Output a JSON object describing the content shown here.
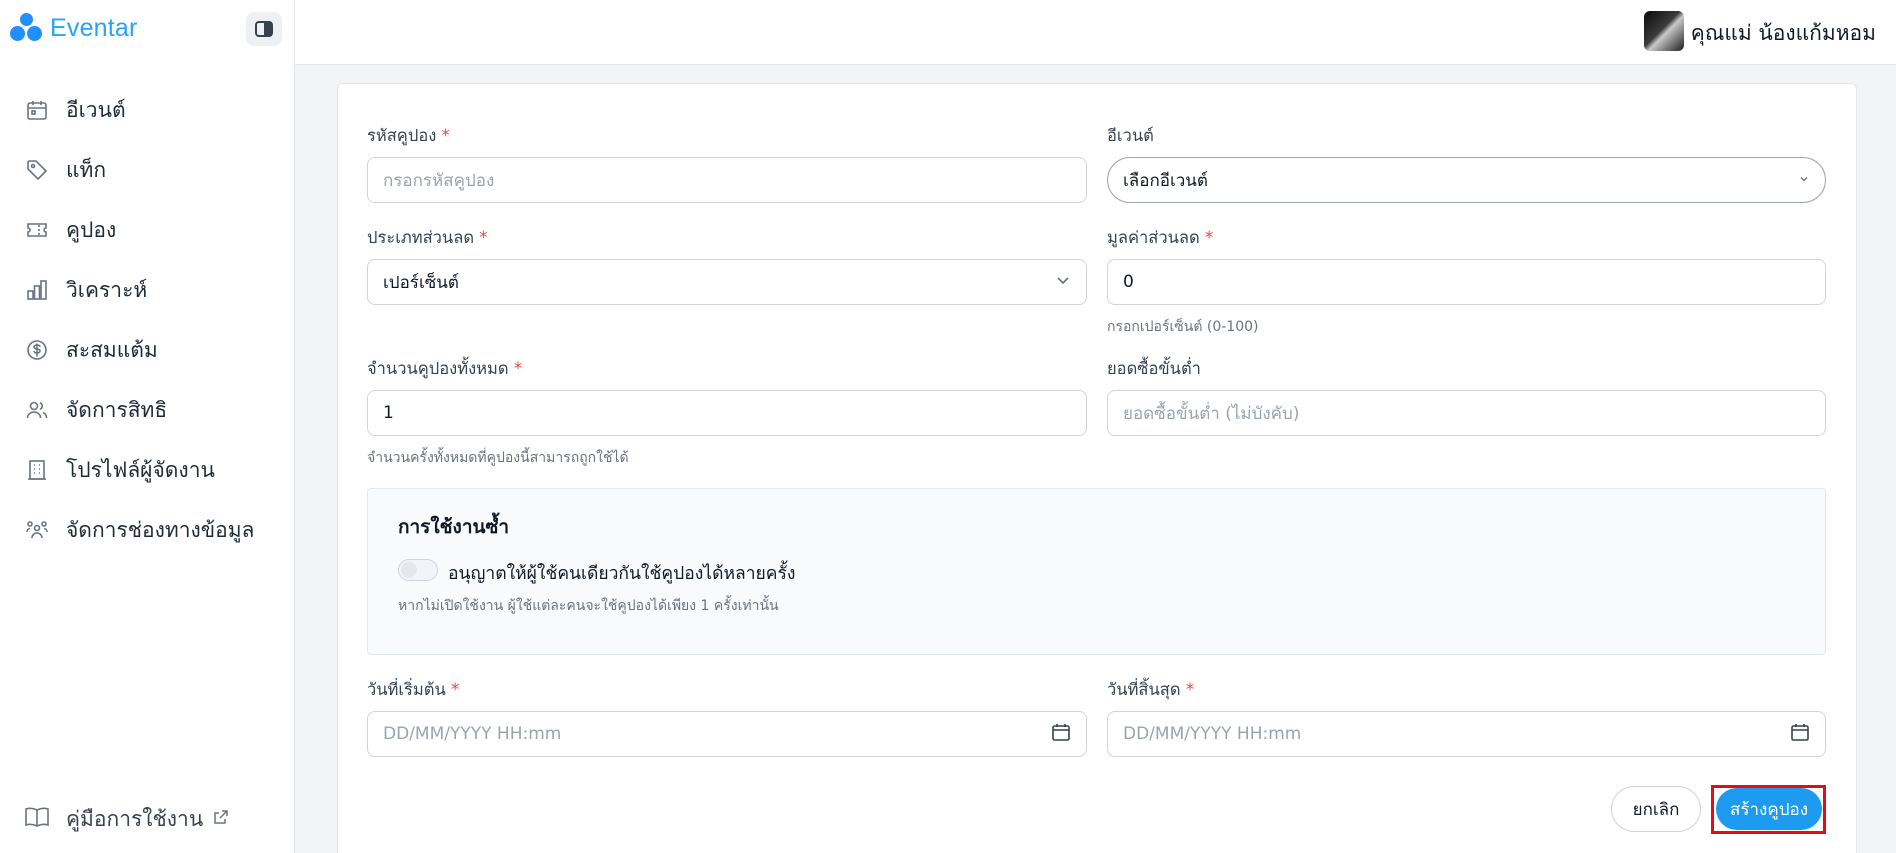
{
  "brand": {
    "name": "Eventar"
  },
  "sidebar": {
    "items": [
      {
        "label": "อีเวนต์",
        "icon": "calendar-icon"
      },
      {
        "label": "แท็ก",
        "icon": "tag-icon"
      },
      {
        "label": "คูปอง",
        "icon": "ticket-icon"
      },
      {
        "label": "วิเคราะห์",
        "icon": "bar-chart-icon"
      },
      {
        "label": "สะสมแต้ม",
        "icon": "dollar-circle-icon"
      },
      {
        "label": "จัดการสิทธิ",
        "icon": "users-icon"
      },
      {
        "label": "โปรไฟล์ผู้จัดงาน",
        "icon": "building-icon"
      },
      {
        "label": "จัดการช่องทางข้อมูล",
        "icon": "people-group-icon"
      }
    ],
    "footer": {
      "label": "คู่มือการใช้งาน",
      "icon": "book-icon"
    }
  },
  "header": {
    "user_name": "คุณแม่ น้องแก้มหอม"
  },
  "form": {
    "coupon_code": {
      "label": "รหัสคูปอง",
      "placeholder": "กรอกรหัสคูปอง"
    },
    "event": {
      "label": "อีเวนต์",
      "value": "เลือกอีเวนต์"
    },
    "discount_type": {
      "label": "ประเภทส่วนลด",
      "value": "เปอร์เซ็นต์"
    },
    "discount_value": {
      "label": "มูลค่าส่วนลด",
      "value": "0",
      "hint": "กรอกเปอร์เซ็นต์ (0-100)"
    },
    "total_coupons": {
      "label": "จำนวนคูปองทั้งหมด",
      "value": "1",
      "hint": "จำนวนครั้งทั้งหมดที่คูปองนี้สามารถถูกใช้ได้"
    },
    "min_purchase": {
      "label": "ยอดซื้อขั้นต่ำ",
      "placeholder": "ยอดซื้อขั้นต่ำ (ไม่บังคับ)"
    },
    "reuse": {
      "title": "การใช้งานซ้ำ",
      "toggle_label": "อนุญาตให้ผู้ใช้คนเดียวกันใช้คูปองได้หลายครั้ง",
      "hint": "หากไม่เปิดใช้งาน ผู้ใช้แต่ละคนจะใช้คูปองได้เพียง 1 ครั้งเท่านั้น",
      "enabled": false
    },
    "start_date": {
      "label": "วันที่เริ่มต้น",
      "placeholder": "DD/MM/YYYY HH:mm"
    },
    "end_date": {
      "label": "วันที่สิ้นสุด",
      "placeholder": "DD/MM/YYYY HH:mm"
    },
    "required_mark": "*",
    "cancel_label": "ยกเลิก",
    "submit_label": "สร้างคูปอง"
  },
  "colors": {
    "accent": "#1d9bf0",
    "required": "#ef4444",
    "highlight": "#e8091b"
  }
}
